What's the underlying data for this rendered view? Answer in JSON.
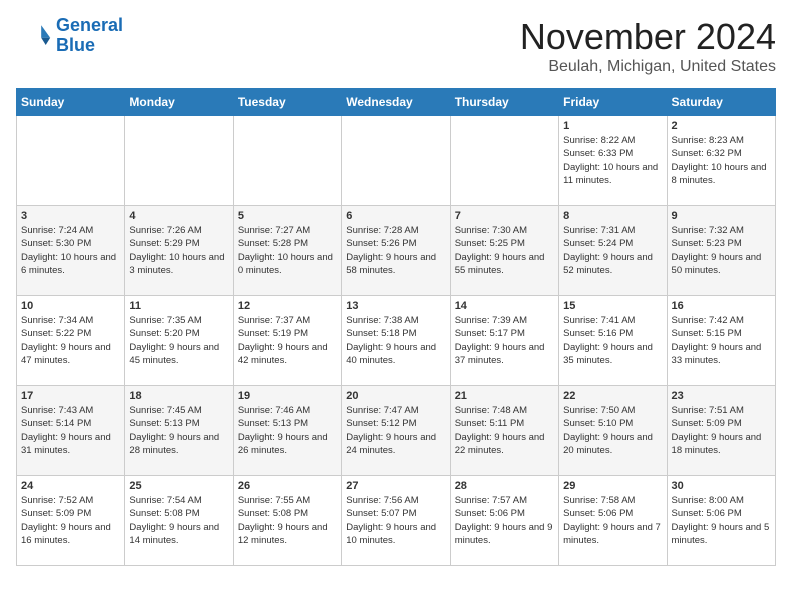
{
  "logo": {
    "line1": "General",
    "line2": "Blue"
  },
  "title": "November 2024",
  "location": "Beulah, Michigan, United States",
  "weekdays": [
    "Sunday",
    "Monday",
    "Tuesday",
    "Wednesday",
    "Thursday",
    "Friday",
    "Saturday"
  ],
  "weeks": [
    [
      {
        "day": "",
        "info": ""
      },
      {
        "day": "",
        "info": ""
      },
      {
        "day": "",
        "info": ""
      },
      {
        "day": "",
        "info": ""
      },
      {
        "day": "",
        "info": ""
      },
      {
        "day": "1",
        "info": "Sunrise: 8:22 AM\nSunset: 6:33 PM\nDaylight: 10 hours and 11 minutes."
      },
      {
        "day": "2",
        "info": "Sunrise: 8:23 AM\nSunset: 6:32 PM\nDaylight: 10 hours and 8 minutes."
      }
    ],
    [
      {
        "day": "3",
        "info": "Sunrise: 7:24 AM\nSunset: 5:30 PM\nDaylight: 10 hours and 6 minutes."
      },
      {
        "day": "4",
        "info": "Sunrise: 7:26 AM\nSunset: 5:29 PM\nDaylight: 10 hours and 3 minutes."
      },
      {
        "day": "5",
        "info": "Sunrise: 7:27 AM\nSunset: 5:28 PM\nDaylight: 10 hours and 0 minutes."
      },
      {
        "day": "6",
        "info": "Sunrise: 7:28 AM\nSunset: 5:26 PM\nDaylight: 9 hours and 58 minutes."
      },
      {
        "day": "7",
        "info": "Sunrise: 7:30 AM\nSunset: 5:25 PM\nDaylight: 9 hours and 55 minutes."
      },
      {
        "day": "8",
        "info": "Sunrise: 7:31 AM\nSunset: 5:24 PM\nDaylight: 9 hours and 52 minutes."
      },
      {
        "day": "9",
        "info": "Sunrise: 7:32 AM\nSunset: 5:23 PM\nDaylight: 9 hours and 50 minutes."
      }
    ],
    [
      {
        "day": "10",
        "info": "Sunrise: 7:34 AM\nSunset: 5:22 PM\nDaylight: 9 hours and 47 minutes."
      },
      {
        "day": "11",
        "info": "Sunrise: 7:35 AM\nSunset: 5:20 PM\nDaylight: 9 hours and 45 minutes."
      },
      {
        "day": "12",
        "info": "Sunrise: 7:37 AM\nSunset: 5:19 PM\nDaylight: 9 hours and 42 minutes."
      },
      {
        "day": "13",
        "info": "Sunrise: 7:38 AM\nSunset: 5:18 PM\nDaylight: 9 hours and 40 minutes."
      },
      {
        "day": "14",
        "info": "Sunrise: 7:39 AM\nSunset: 5:17 PM\nDaylight: 9 hours and 37 minutes."
      },
      {
        "day": "15",
        "info": "Sunrise: 7:41 AM\nSunset: 5:16 PM\nDaylight: 9 hours and 35 minutes."
      },
      {
        "day": "16",
        "info": "Sunrise: 7:42 AM\nSunset: 5:15 PM\nDaylight: 9 hours and 33 minutes."
      }
    ],
    [
      {
        "day": "17",
        "info": "Sunrise: 7:43 AM\nSunset: 5:14 PM\nDaylight: 9 hours and 31 minutes."
      },
      {
        "day": "18",
        "info": "Sunrise: 7:45 AM\nSunset: 5:13 PM\nDaylight: 9 hours and 28 minutes."
      },
      {
        "day": "19",
        "info": "Sunrise: 7:46 AM\nSunset: 5:13 PM\nDaylight: 9 hours and 26 minutes."
      },
      {
        "day": "20",
        "info": "Sunrise: 7:47 AM\nSunset: 5:12 PM\nDaylight: 9 hours and 24 minutes."
      },
      {
        "day": "21",
        "info": "Sunrise: 7:48 AM\nSunset: 5:11 PM\nDaylight: 9 hours and 22 minutes."
      },
      {
        "day": "22",
        "info": "Sunrise: 7:50 AM\nSunset: 5:10 PM\nDaylight: 9 hours and 20 minutes."
      },
      {
        "day": "23",
        "info": "Sunrise: 7:51 AM\nSunset: 5:09 PM\nDaylight: 9 hours and 18 minutes."
      }
    ],
    [
      {
        "day": "24",
        "info": "Sunrise: 7:52 AM\nSunset: 5:09 PM\nDaylight: 9 hours and 16 minutes."
      },
      {
        "day": "25",
        "info": "Sunrise: 7:54 AM\nSunset: 5:08 PM\nDaylight: 9 hours and 14 minutes."
      },
      {
        "day": "26",
        "info": "Sunrise: 7:55 AM\nSunset: 5:08 PM\nDaylight: 9 hours and 12 minutes."
      },
      {
        "day": "27",
        "info": "Sunrise: 7:56 AM\nSunset: 5:07 PM\nDaylight: 9 hours and 10 minutes."
      },
      {
        "day": "28",
        "info": "Sunrise: 7:57 AM\nSunset: 5:06 PM\nDaylight: 9 hours and 9 minutes."
      },
      {
        "day": "29",
        "info": "Sunrise: 7:58 AM\nSunset: 5:06 PM\nDaylight: 9 hours and 7 minutes."
      },
      {
        "day": "30",
        "info": "Sunrise: 8:00 AM\nSunset: 5:06 PM\nDaylight: 9 hours and 5 minutes."
      }
    ]
  ]
}
